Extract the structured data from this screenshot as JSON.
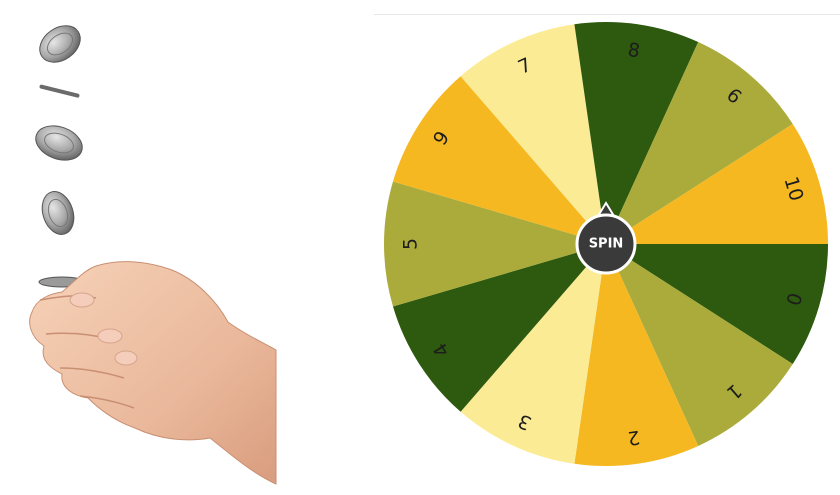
{
  "wheel": {
    "spin_label": "SPIN",
    "slices": [
      {
        "label": "0",
        "color": "#2d5a0e"
      },
      {
        "label": "1",
        "color": "#abab3c"
      },
      {
        "label": "2",
        "color": "#f6b820"
      },
      {
        "label": "3",
        "color": "#fbeb94"
      },
      {
        "label": "4",
        "color": "#2d5a0e"
      },
      {
        "label": "5",
        "color": "#abab3c"
      },
      {
        "label": "9",
        "color": "#f6b820"
      },
      {
        "label": "7",
        "color": "#fbeb94"
      },
      {
        "label": "8",
        "color": "#2d5a0e"
      },
      {
        "label": "6",
        "color": "#abab3c"
      },
      {
        "label": "10",
        "color": "#f6b820"
      }
    ],
    "hub_color": "#3a3a3a",
    "hub_border": "#ffffff"
  },
  "illustration": {
    "subject": "hand-flipping-coin",
    "coin_color": "#b8b8b8",
    "skin_color": "#f0c4a6"
  }
}
